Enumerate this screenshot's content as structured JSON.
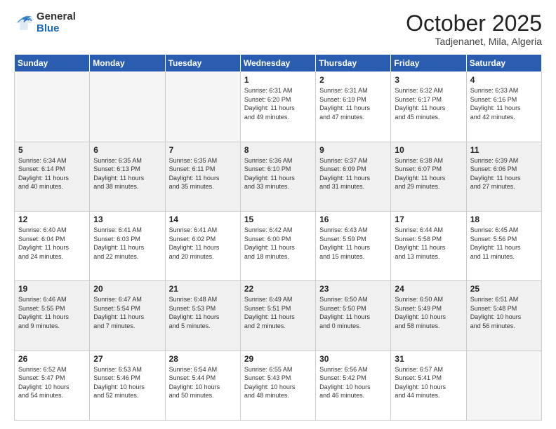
{
  "header": {
    "logo_general": "General",
    "logo_blue": "Blue",
    "month": "October 2025",
    "location": "Tadjenanet, Mila, Algeria"
  },
  "weekdays": [
    "Sunday",
    "Monday",
    "Tuesday",
    "Wednesday",
    "Thursday",
    "Friday",
    "Saturday"
  ],
  "weeks": [
    [
      {
        "day": "",
        "info": ""
      },
      {
        "day": "",
        "info": ""
      },
      {
        "day": "",
        "info": ""
      },
      {
        "day": "1",
        "info": "Sunrise: 6:31 AM\nSunset: 6:20 PM\nDaylight: 11 hours\nand 49 minutes."
      },
      {
        "day": "2",
        "info": "Sunrise: 6:31 AM\nSunset: 6:19 PM\nDaylight: 11 hours\nand 47 minutes."
      },
      {
        "day": "3",
        "info": "Sunrise: 6:32 AM\nSunset: 6:17 PM\nDaylight: 11 hours\nand 45 minutes."
      },
      {
        "day": "4",
        "info": "Sunrise: 6:33 AM\nSunset: 6:16 PM\nDaylight: 11 hours\nand 42 minutes."
      }
    ],
    [
      {
        "day": "5",
        "info": "Sunrise: 6:34 AM\nSunset: 6:14 PM\nDaylight: 11 hours\nand 40 minutes."
      },
      {
        "day": "6",
        "info": "Sunrise: 6:35 AM\nSunset: 6:13 PM\nDaylight: 11 hours\nand 38 minutes."
      },
      {
        "day": "7",
        "info": "Sunrise: 6:35 AM\nSunset: 6:11 PM\nDaylight: 11 hours\nand 35 minutes."
      },
      {
        "day": "8",
        "info": "Sunrise: 6:36 AM\nSunset: 6:10 PM\nDaylight: 11 hours\nand 33 minutes."
      },
      {
        "day": "9",
        "info": "Sunrise: 6:37 AM\nSunset: 6:09 PM\nDaylight: 11 hours\nand 31 minutes."
      },
      {
        "day": "10",
        "info": "Sunrise: 6:38 AM\nSunset: 6:07 PM\nDaylight: 11 hours\nand 29 minutes."
      },
      {
        "day": "11",
        "info": "Sunrise: 6:39 AM\nSunset: 6:06 PM\nDaylight: 11 hours\nand 27 minutes."
      }
    ],
    [
      {
        "day": "12",
        "info": "Sunrise: 6:40 AM\nSunset: 6:04 PM\nDaylight: 11 hours\nand 24 minutes."
      },
      {
        "day": "13",
        "info": "Sunrise: 6:41 AM\nSunset: 6:03 PM\nDaylight: 11 hours\nand 22 minutes."
      },
      {
        "day": "14",
        "info": "Sunrise: 6:41 AM\nSunset: 6:02 PM\nDaylight: 11 hours\nand 20 minutes."
      },
      {
        "day": "15",
        "info": "Sunrise: 6:42 AM\nSunset: 6:00 PM\nDaylight: 11 hours\nand 18 minutes."
      },
      {
        "day": "16",
        "info": "Sunrise: 6:43 AM\nSunset: 5:59 PM\nDaylight: 11 hours\nand 15 minutes."
      },
      {
        "day": "17",
        "info": "Sunrise: 6:44 AM\nSunset: 5:58 PM\nDaylight: 11 hours\nand 13 minutes."
      },
      {
        "day": "18",
        "info": "Sunrise: 6:45 AM\nSunset: 5:56 PM\nDaylight: 11 hours\nand 11 minutes."
      }
    ],
    [
      {
        "day": "19",
        "info": "Sunrise: 6:46 AM\nSunset: 5:55 PM\nDaylight: 11 hours\nand 9 minutes."
      },
      {
        "day": "20",
        "info": "Sunrise: 6:47 AM\nSunset: 5:54 PM\nDaylight: 11 hours\nand 7 minutes."
      },
      {
        "day": "21",
        "info": "Sunrise: 6:48 AM\nSunset: 5:53 PM\nDaylight: 11 hours\nand 5 minutes."
      },
      {
        "day": "22",
        "info": "Sunrise: 6:49 AM\nSunset: 5:51 PM\nDaylight: 11 hours\nand 2 minutes."
      },
      {
        "day": "23",
        "info": "Sunrise: 6:50 AM\nSunset: 5:50 PM\nDaylight: 11 hours\nand 0 minutes."
      },
      {
        "day": "24",
        "info": "Sunrise: 6:50 AM\nSunset: 5:49 PM\nDaylight: 10 hours\nand 58 minutes."
      },
      {
        "day": "25",
        "info": "Sunrise: 6:51 AM\nSunset: 5:48 PM\nDaylight: 10 hours\nand 56 minutes."
      }
    ],
    [
      {
        "day": "26",
        "info": "Sunrise: 6:52 AM\nSunset: 5:47 PM\nDaylight: 10 hours\nand 54 minutes."
      },
      {
        "day": "27",
        "info": "Sunrise: 6:53 AM\nSunset: 5:46 PM\nDaylight: 10 hours\nand 52 minutes."
      },
      {
        "day": "28",
        "info": "Sunrise: 6:54 AM\nSunset: 5:44 PM\nDaylight: 10 hours\nand 50 minutes."
      },
      {
        "day": "29",
        "info": "Sunrise: 6:55 AM\nSunset: 5:43 PM\nDaylight: 10 hours\nand 48 minutes."
      },
      {
        "day": "30",
        "info": "Sunrise: 6:56 AM\nSunset: 5:42 PM\nDaylight: 10 hours\nand 46 minutes."
      },
      {
        "day": "31",
        "info": "Sunrise: 6:57 AM\nSunset: 5:41 PM\nDaylight: 10 hours\nand 44 minutes."
      },
      {
        "day": "",
        "info": ""
      }
    ]
  ]
}
